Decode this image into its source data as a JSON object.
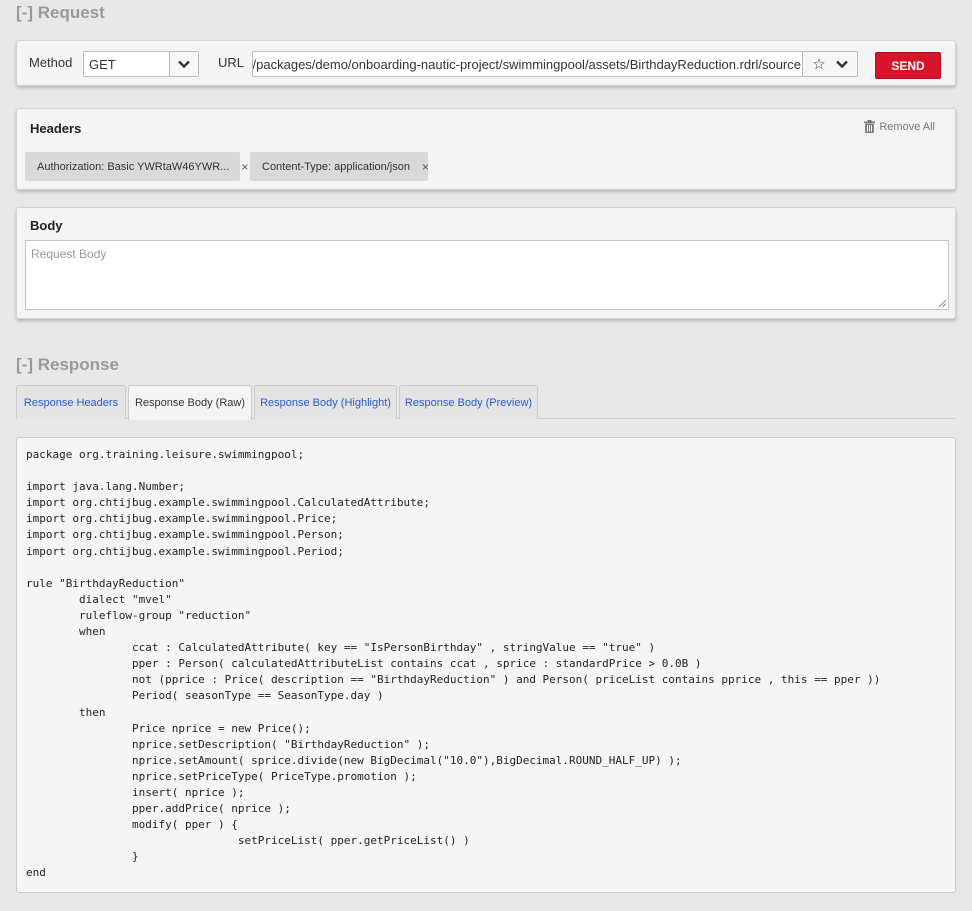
{
  "request": {
    "section_title": "[-] Request",
    "method_label": "Method",
    "method_value": "GET",
    "url_label": "URL",
    "url_value": "wb/rest/packages/demo/onboarding-nautic-project/swimmingpool/assets/BirthdayReduction.rdrl/source",
    "send_label": "SEND",
    "icons": {
      "method_dropdown": "chevron-down-icon",
      "favorite": "star-icon",
      "url_dropdown": "chevron-down-icon"
    }
  },
  "headers": {
    "title": "Headers",
    "remove_all_label": "Remove All",
    "items": [
      {
        "label": "Authorization: Basic YWRtaW46YWR...",
        "remove": "×"
      },
      {
        "label": "Content-Type: application/json",
        "remove": "×"
      }
    ]
  },
  "body": {
    "title": "Body",
    "placeholder": "Request Body"
  },
  "response": {
    "section_title": "[-] Response",
    "tabs": [
      {
        "label": "Response Headers",
        "active": false
      },
      {
        "label": "Response Body (Raw)",
        "active": true
      },
      {
        "label": "Response Body (Highlight)",
        "active": false
      },
      {
        "label": "Response Body (Preview)",
        "active": false
      }
    ],
    "body_raw": "package org.training.leisure.swimmingpool;\n\nimport java.lang.Number;\nimport org.chtijbug.example.swimmingpool.CalculatedAttribute;\nimport org.chtijbug.example.swimmingpool.Price;\nimport org.chtijbug.example.swimmingpool.Person;\nimport org.chtijbug.example.swimmingpool.Period;\n\nrule \"BirthdayReduction\"\n        dialect \"mvel\"\n        ruleflow-group \"reduction\"\n        when\n                ccat : CalculatedAttribute( key == \"IsPersonBirthday\" , stringValue == \"true\" )\n                pper : Person( calculatedAttributeList contains ccat , sprice : standardPrice > 0.0B )\n                not (pprice : Price( description == \"BirthdayReduction\" ) and Person( priceList contains pprice , this == pper ))\n                Period( seasonType == SeasonType.day )\n        then\n                Price nprice = new Price();\n                nprice.setDescription( \"BirthdayReduction\" );\n                nprice.setAmount( sprice.divide(new BigDecimal(\"10.0\"),BigDecimal.ROUND_HALF_UP) );\n                nprice.setPriceType( PriceType.promotion );\n                insert( nprice );\n                pper.addPrice( nprice );\n                modify( pper ) {\n                                setPriceList( pper.getPriceList() )\n                }\nend"
  },
  "colors": {
    "send_button": "#d8132a",
    "tab_link": "#2a5bd0",
    "section_title": "#9a9a9a"
  }
}
